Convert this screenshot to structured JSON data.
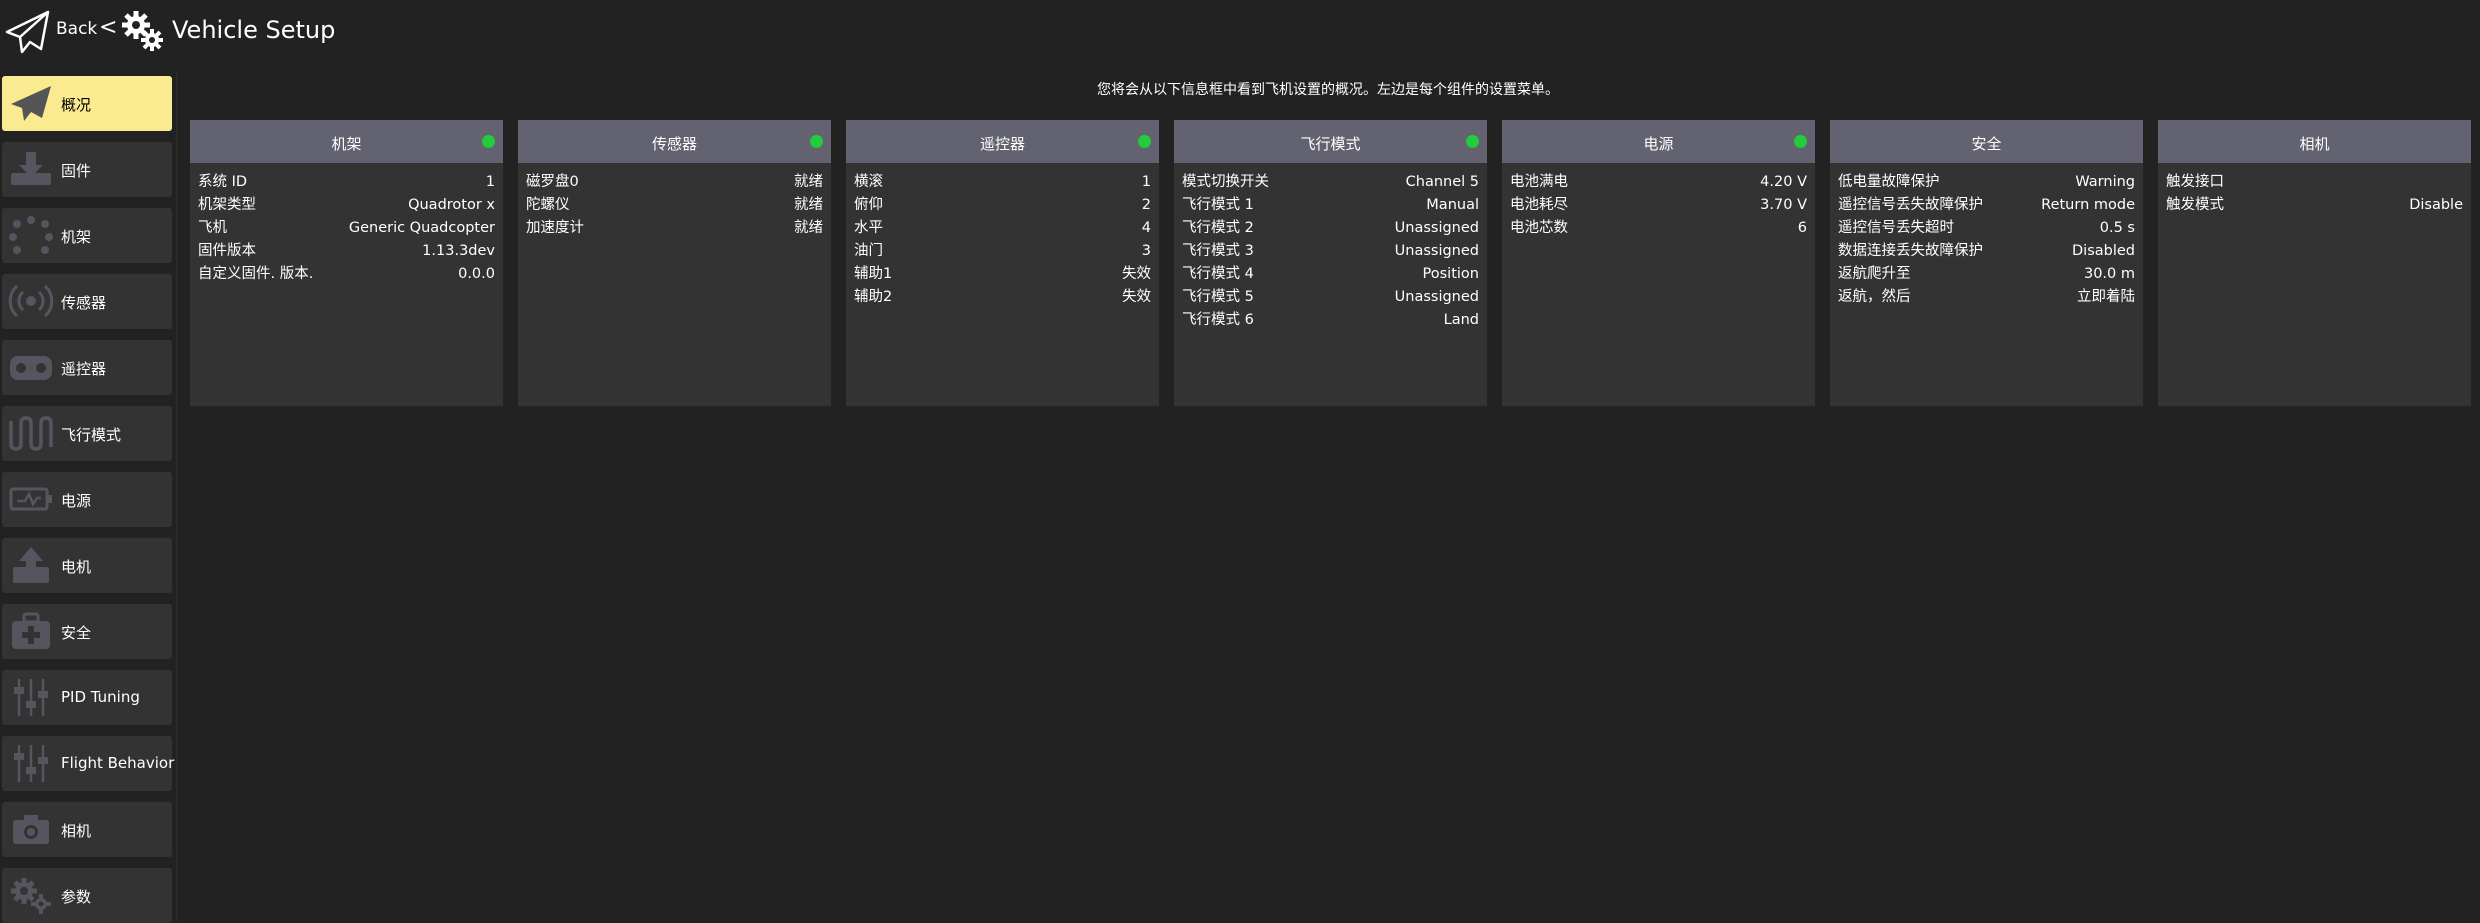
{
  "header": {
    "back_label": "Back",
    "separator": "<",
    "title": "Vehicle Setup"
  },
  "sidebar": {
    "items": [
      {
        "label": "概况",
        "icon": "paper-plane-icon",
        "active": true
      },
      {
        "label": "固件",
        "icon": "download-icon"
      },
      {
        "label": "机架",
        "icon": "airframe-icon"
      },
      {
        "label": "传感器",
        "icon": "sensor-waves-icon"
      },
      {
        "label": "遥控器",
        "icon": "radio-controller-icon"
      },
      {
        "label": "飞行模式",
        "icon": "flight-modes-wave-icon"
      },
      {
        "label": "电源",
        "icon": "battery-icon"
      },
      {
        "label": "电机",
        "icon": "motor-icon"
      },
      {
        "label": "安全",
        "icon": "medkit-icon"
      },
      {
        "label": "PID Tuning",
        "icon": "sliders-icon"
      },
      {
        "label": "Flight Behavior",
        "icon": "sliders-icon"
      },
      {
        "label": "相机",
        "icon": "camera-icon"
      },
      {
        "label": "参数",
        "icon": "gears-icon"
      }
    ]
  },
  "intro_text": "您将会从以下信息框中看到飞机设置的概况。左边是每个组件的设置菜单。",
  "status_color": "#22cc3a",
  "cards": [
    {
      "title": "机架",
      "status": true,
      "rows": [
        {
          "k": "系统 ID",
          "v": "1"
        },
        {
          "k": "机架类型",
          "v": "Quadrotor x"
        },
        {
          "k": "飞机",
          "v": "Generic Quadcopter"
        },
        {
          "k": "固件版本",
          "v": "1.13.3dev"
        },
        {
          "k": "自定义固件. 版本.",
          "v": "0.0.0"
        }
      ]
    },
    {
      "title": "传感器",
      "status": true,
      "rows": [
        {
          "k": "磁罗盘0",
          "v": "就绪"
        },
        {
          "k": "陀螺仪",
          "v": "就绪"
        },
        {
          "k": "加速度计",
          "v": "就绪"
        }
      ]
    },
    {
      "title": "遥控器",
      "status": true,
      "rows": [
        {
          "k": "横滚",
          "v": "1"
        },
        {
          "k": "俯仰",
          "v": "2"
        },
        {
          "k": "水平",
          "v": "4"
        },
        {
          "k": "油门",
          "v": "3"
        },
        {
          "k": "辅助1",
          "v": "失效"
        },
        {
          "k": "辅助2",
          "v": "失效"
        }
      ]
    },
    {
      "title": "飞行模式",
      "status": true,
      "rows": [
        {
          "k": "模式切换开关",
          "v": "Channel 5"
        },
        {
          "k": "飞行模式 1",
          "v": "Manual"
        },
        {
          "k": "飞行模式 2",
          "v": "Unassigned"
        },
        {
          "k": "飞行模式 3",
          "v": "Unassigned"
        },
        {
          "k": "飞行模式 4",
          "v": "Position"
        },
        {
          "k": "飞行模式 5",
          "v": "Unassigned"
        },
        {
          "k": "飞行模式 6",
          "v": "Land"
        }
      ]
    },
    {
      "title": "电源",
      "status": true,
      "rows": [
        {
          "k": "电池满电",
          "v": "4.20 V"
        },
        {
          "k": "电池耗尽",
          "v": "3.70 V"
        },
        {
          "k": "电池芯数",
          "v": "6"
        }
      ]
    },
    {
      "title": "安全",
      "status": false,
      "rows": [
        {
          "k": "低电量故障保护",
          "v": "Warning"
        },
        {
          "k": "遥控信号丢失故障保护",
          "v": "Return mode"
        },
        {
          "k": "遥控信号丢失超时",
          "v": "0.5 s"
        },
        {
          "k": "数据连接丢失故障保护",
          "v": "Disabled"
        },
        {
          "k": "返航爬升至",
          "v": "30.0 m"
        },
        {
          "k": "返航，然后",
          "v": "立即着陆"
        }
      ]
    },
    {
      "title": "相机",
      "status": false,
      "rows": [
        {
          "k": "触发接口",
          "v": ""
        },
        {
          "k": "触发模式",
          "v": "Disable"
        }
      ]
    }
  ]
}
